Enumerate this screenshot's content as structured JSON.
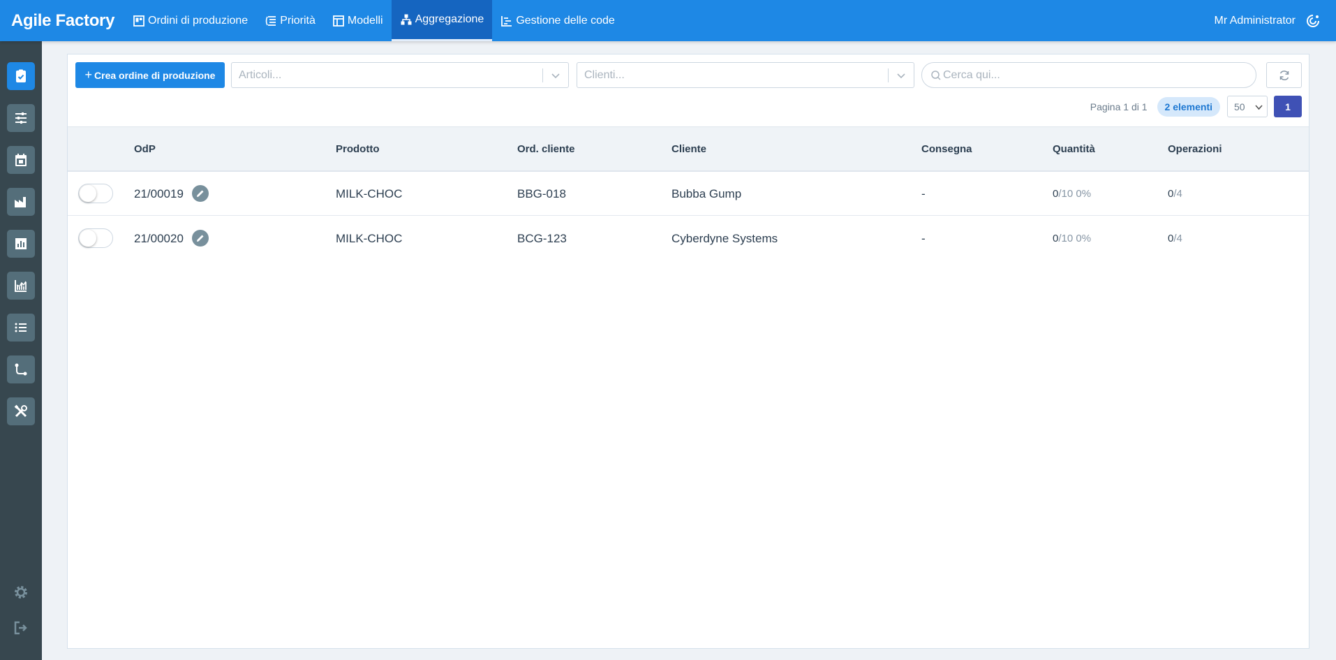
{
  "app": {
    "brand": "Agile Factory",
    "user": "Mr Administrator"
  },
  "nav": [
    {
      "label": "Ordini di produzione",
      "icon": "board-icon",
      "active": false
    },
    {
      "label": "Priorità",
      "icon": "priority-icon",
      "active": false
    },
    {
      "label": "Modelli",
      "icon": "template-icon",
      "active": false
    },
    {
      "label": "Aggregazione",
      "icon": "hierarchy-icon",
      "active": true
    },
    {
      "label": "Gestione delle code",
      "icon": "queue-icon",
      "active": false
    }
  ],
  "sidebar": {
    "items": [
      {
        "icon": "clipboard-check-icon",
        "active": true
      },
      {
        "icon": "sliders-icon",
        "active": false
      },
      {
        "icon": "calendar-icon",
        "active": false
      },
      {
        "icon": "factory-icon",
        "active": false
      },
      {
        "icon": "bar-chart-icon",
        "active": false
      },
      {
        "icon": "line-chart-icon",
        "active": false
      },
      {
        "icon": "list-icon",
        "active": false
      },
      {
        "icon": "route-icon",
        "active": false
      },
      {
        "icon": "tools-icon",
        "active": false
      }
    ],
    "bottom": [
      "gear-icon",
      "logout-icon"
    ]
  },
  "toolbar": {
    "create_label": "Crea ordine di produzione",
    "articles_placeholder": "Articoli...",
    "clients_placeholder": "Clienti...",
    "search_placeholder": "Cerca qui..."
  },
  "pager": {
    "page_info": "Pagina 1 di 1",
    "count_badge": "2 elementi",
    "per_page": "50",
    "current_page": "1"
  },
  "table": {
    "columns": {
      "odp": "OdP",
      "product": "Prodotto",
      "client_order": "Ord. cliente",
      "client": "Cliente",
      "delivery": "Consegna",
      "quantity": "Quantità",
      "operations": "Operazioni"
    },
    "rows": [
      {
        "odp": "21/00019",
        "product": "MILK-CHOC",
        "client_order": "BBG-018",
        "client": "Bubba Gump",
        "delivery": "-",
        "qty_done": "0",
        "qty_total": "/10",
        "qty_pct": "0%",
        "ops_done": "0",
        "ops_total": "/4"
      },
      {
        "odp": "21/00020",
        "product": "MILK-CHOC",
        "client_order": "BCG-123",
        "client": "Cyberdyne Systems",
        "delivery": "-",
        "qty_done": "0",
        "qty_total": "/10",
        "qty_pct": "0%",
        "ops_done": "0",
        "ops_total": "/4"
      }
    ]
  }
}
